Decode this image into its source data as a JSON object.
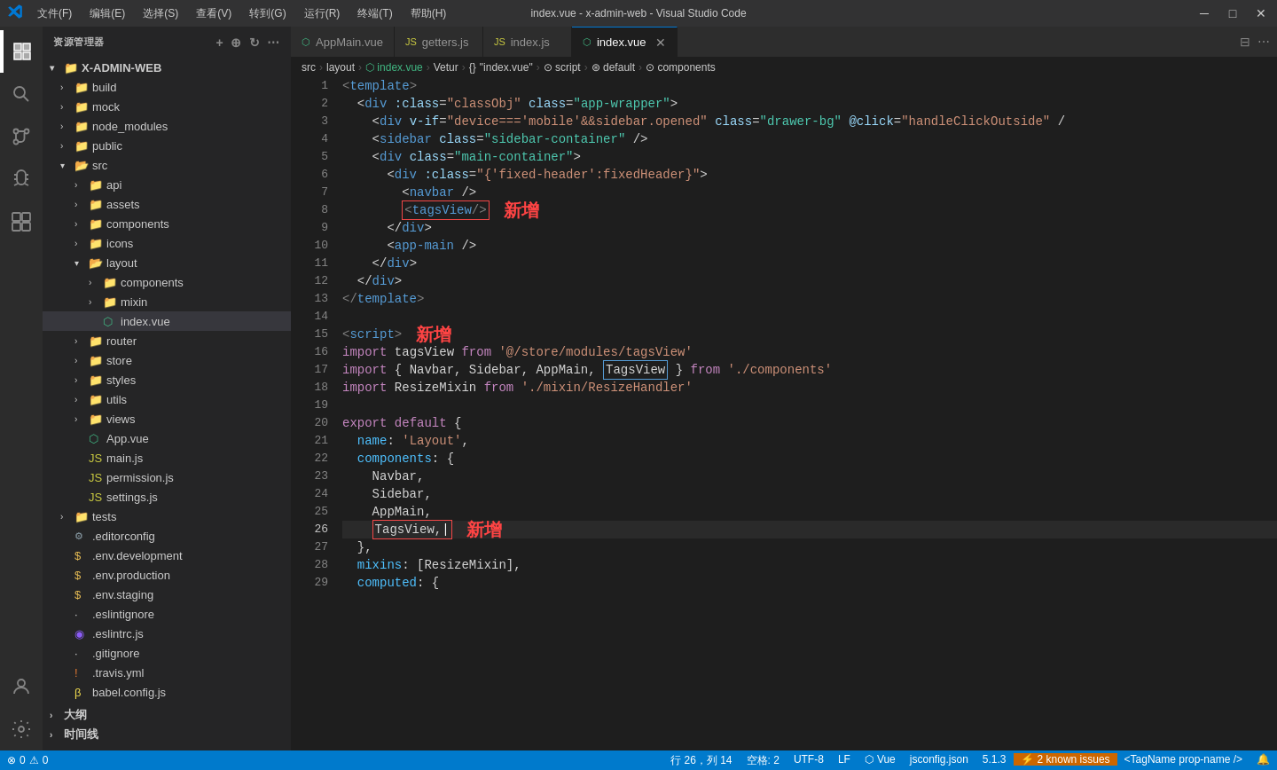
{
  "titleBar": {
    "logo": "X",
    "menus": [
      "文件(F)",
      "编辑(E)",
      "选择(S)",
      "查看(V)",
      "转到(G)",
      "运行(R)",
      "终端(T)",
      "帮助(H)"
    ],
    "title": "index.vue - x-admin-web - Visual Studio Code",
    "btnMin": "─",
    "btnMax": "□",
    "btnClose": "✕"
  },
  "sidebar": {
    "header": "资源管理器",
    "root": "X-ADMIN-WEB",
    "items": [
      {
        "label": "build",
        "depth": 1,
        "type": "folder",
        "collapsed": true
      },
      {
        "label": "mock",
        "depth": 1,
        "type": "folder",
        "collapsed": true
      },
      {
        "label": "node_modules",
        "depth": 1,
        "type": "folder",
        "collapsed": true
      },
      {
        "label": "public",
        "depth": 1,
        "type": "folder",
        "collapsed": true
      },
      {
        "label": "src",
        "depth": 1,
        "type": "folder",
        "collapsed": false
      },
      {
        "label": "api",
        "depth": 2,
        "type": "folder",
        "collapsed": true
      },
      {
        "label": "assets",
        "depth": 2,
        "type": "folder",
        "collapsed": true
      },
      {
        "label": "components",
        "depth": 2,
        "type": "folder",
        "collapsed": true
      },
      {
        "label": "icons",
        "depth": 2,
        "type": "folder",
        "collapsed": true
      },
      {
        "label": "layout",
        "depth": 2,
        "type": "folder",
        "collapsed": false
      },
      {
        "label": "components",
        "depth": 3,
        "type": "folder",
        "collapsed": true
      },
      {
        "label": "mixin",
        "depth": 3,
        "type": "folder",
        "collapsed": true
      },
      {
        "label": "index.vue",
        "depth": 3,
        "type": "vue",
        "active": true
      },
      {
        "label": "router",
        "depth": 2,
        "type": "folder",
        "collapsed": true
      },
      {
        "label": "store",
        "depth": 2,
        "type": "folder",
        "collapsed": true
      },
      {
        "label": "styles",
        "depth": 2,
        "type": "folder",
        "collapsed": true
      },
      {
        "label": "utils",
        "depth": 2,
        "type": "folder",
        "collapsed": true
      },
      {
        "label": "views",
        "depth": 2,
        "type": "folder",
        "collapsed": true
      },
      {
        "label": "App.vue",
        "depth": 2,
        "type": "vue"
      },
      {
        "label": "main.js",
        "depth": 2,
        "type": "js"
      },
      {
        "label": "permission.js",
        "depth": 2,
        "type": "js"
      },
      {
        "label": "settings.js",
        "depth": 2,
        "type": "js"
      },
      {
        "label": "tests",
        "depth": 1,
        "type": "folder",
        "collapsed": true
      },
      {
        "label": ".editorconfig",
        "depth": 1,
        "type": "config"
      },
      {
        "label": ".env.development",
        "depth": 1,
        "type": "env"
      },
      {
        "label": ".env.production",
        "depth": 1,
        "type": "env"
      },
      {
        "label": ".env.staging",
        "depth": 1,
        "type": "env"
      },
      {
        "label": ".eslintignore",
        "depth": 1,
        "type": "text"
      },
      {
        "label": ".eslintrc.js",
        "depth": 1,
        "type": "eslint"
      },
      {
        "label": ".gitignore",
        "depth": 1,
        "type": "text"
      },
      {
        "label": ".travis.yml",
        "depth": 1,
        "type": "yaml"
      },
      {
        "label": "babel.config.js",
        "depth": 1,
        "type": "babel"
      }
    ]
  },
  "tabs": [
    {
      "label": "AppMain.vue",
      "type": "vue",
      "active": false
    },
    {
      "label": "getters.js",
      "type": "js",
      "active": false
    },
    {
      "label": "index.js",
      "type": "js",
      "active": false
    },
    {
      "label": "index.vue",
      "type": "vue",
      "active": true,
      "closable": true
    }
  ],
  "breadcrumb": {
    "items": [
      "src",
      ">",
      "layout",
      ">",
      "index.vue",
      ">",
      "Vetur",
      ">",
      "{}",
      "\"index.vue\"",
      ">",
      "⊙ script",
      ">",
      "⊛ default",
      ">",
      "⊙ components"
    ]
  },
  "codeLines": [
    {
      "num": 1,
      "content": "<template>"
    },
    {
      "num": 2,
      "content": "  <div :class=\"classObj\" class=\"app-wrapper\">"
    },
    {
      "num": 3,
      "content": "    <div v-if=\"device==='mobile'&&sidebar.opened\" class=\"drawer-bg\" @click=\"handleClickOutside\" /"
    },
    {
      "num": 4,
      "content": "    <sidebar class=\"sidebar-container\" />"
    },
    {
      "num": 5,
      "content": "    <div class=\"main-container\">"
    },
    {
      "num": 6,
      "content": "      <div :class=\"{'fixed-header':fixedHeader}\">"
    },
    {
      "num": 7,
      "content": "        <navbar />"
    },
    {
      "num": 8,
      "content": "        <tagsView/>"
    },
    {
      "num": 9,
      "content": "      </div>"
    },
    {
      "num": 10,
      "content": "      <app-main />"
    },
    {
      "num": 11,
      "content": "    </div>"
    },
    {
      "num": 12,
      "content": "  </div>"
    },
    {
      "num": 13,
      "content": "</template>"
    },
    {
      "num": 14,
      "content": ""
    },
    {
      "num": 15,
      "content": "<script>"
    },
    {
      "num": 16,
      "content": "import tagsView from '@/store/modules/tagsView'"
    },
    {
      "num": 17,
      "content": "import { Navbar, Sidebar, AppMain, TagsView } from './components'"
    },
    {
      "num": 18,
      "content": "import ResizeMixin from './mixin/ResizeHandler'"
    },
    {
      "num": 19,
      "content": ""
    },
    {
      "num": 20,
      "content": "export default {"
    },
    {
      "num": 21,
      "content": "  name: 'Layout',"
    },
    {
      "num": 22,
      "content": "  components: {"
    },
    {
      "num": 23,
      "content": "    Navbar,"
    },
    {
      "num": 24,
      "content": "    Sidebar,"
    },
    {
      "num": 25,
      "content": "    AppMain,"
    },
    {
      "num": 26,
      "content": "    TagsView,"
    },
    {
      "num": 27,
      "content": "  },"
    },
    {
      "num": 28,
      "content": "  mixins: [ResizeMixin],"
    },
    {
      "num": 29,
      "content": "  computed: {"
    }
  ],
  "annotations": {
    "xinzeng1": "新增",
    "xinzeng2": "新增",
    "xinzeng3": "新增"
  },
  "statusBar": {
    "errors": "0",
    "warnings": "0",
    "line": "行 26，列 14",
    "spaces": "空格: 2",
    "encoding": "UTF-8",
    "lineEnding": "LF",
    "language": "Vue",
    "configFile": "jsconfig.json",
    "version": "5.1.3",
    "knownIssues": "2 known issues",
    "tagName": "<TagName prop-name />"
  }
}
